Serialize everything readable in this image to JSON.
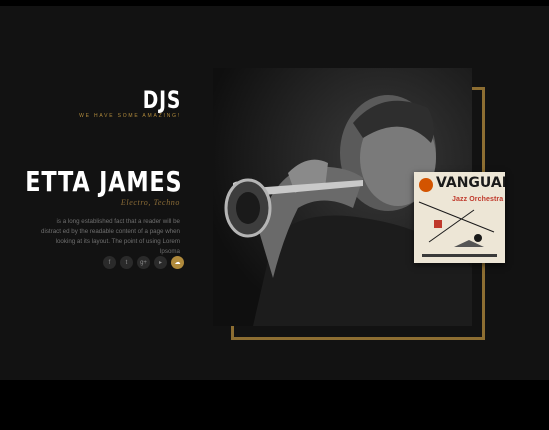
{
  "section": {
    "title": "DJS",
    "subtitle": "WE HAVE SOME AMAZING!"
  },
  "artist": {
    "name": "ETTA JAMES",
    "genre": "Electro, Techno",
    "description": "is a long established fact that a reader will be distract ed by the readable content of a page when looking at its layout. The point of using Lorem Ipsoma"
  },
  "socials": [
    {
      "name": "facebook-icon",
      "glyph": "f"
    },
    {
      "name": "twitter-icon",
      "glyph": "t"
    },
    {
      "name": "google-plus-icon",
      "glyph": "g+"
    },
    {
      "name": "youtube-icon",
      "glyph": "▸"
    },
    {
      "name": "soundcloud-icon",
      "glyph": "☁"
    }
  ],
  "album": {
    "title": "Jazz Orchestra",
    "header": "VANGUARD"
  },
  "colors": {
    "accent": "#b08a3c",
    "frame": "#8d6e32",
    "background": "#121212"
  }
}
